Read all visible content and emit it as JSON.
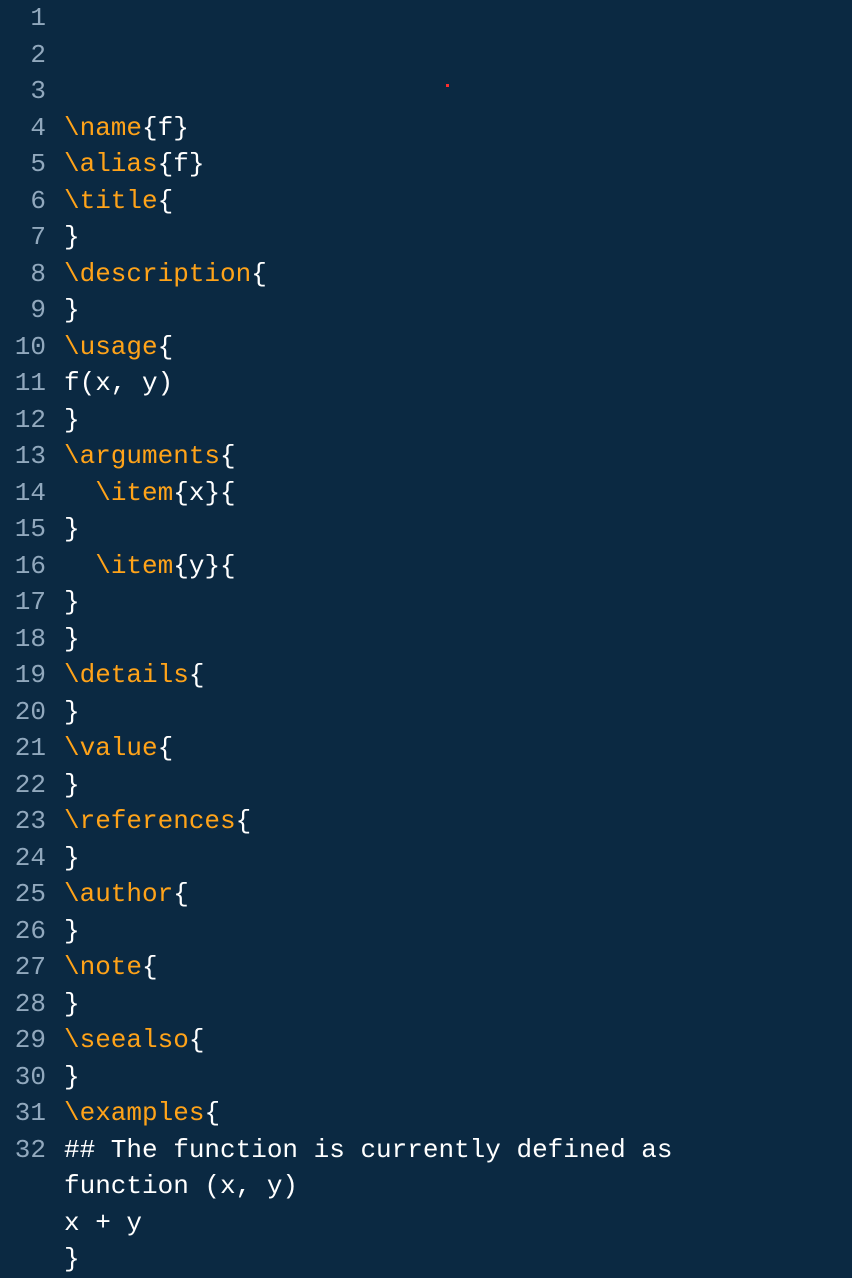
{
  "lines": [
    {
      "num": 1,
      "tokens": [
        {
          "t": "kw",
          "v": "\\name"
        },
        {
          "t": "brace",
          "v": "{"
        },
        {
          "t": "arg",
          "v": "f"
        },
        {
          "t": "brace",
          "v": "}"
        }
      ]
    },
    {
      "num": 2,
      "tokens": [
        {
          "t": "kw",
          "v": "\\alias"
        },
        {
          "t": "brace",
          "v": "{"
        },
        {
          "t": "arg",
          "v": "f"
        },
        {
          "t": "brace",
          "v": "}"
        }
      ]
    },
    {
      "num": 3,
      "tokens": [
        {
          "t": "kw",
          "v": "\\title"
        },
        {
          "t": "brace",
          "v": "{"
        }
      ]
    },
    {
      "num": 4,
      "tokens": [
        {
          "t": "brace",
          "v": "}"
        }
      ]
    },
    {
      "num": 5,
      "tokens": [
        {
          "t": "kw",
          "v": "\\description"
        },
        {
          "t": "brace",
          "v": "{"
        }
      ]
    },
    {
      "num": 6,
      "tokens": [
        {
          "t": "brace",
          "v": "}"
        }
      ]
    },
    {
      "num": 7,
      "tokens": [
        {
          "t": "kw",
          "v": "\\usage"
        },
        {
          "t": "brace",
          "v": "{"
        }
      ]
    },
    {
      "num": 8,
      "tokens": [
        {
          "t": "txt",
          "v": "f(x, y)"
        }
      ]
    },
    {
      "num": 9,
      "tokens": [
        {
          "t": "brace",
          "v": "}"
        }
      ]
    },
    {
      "num": 10,
      "tokens": [
        {
          "t": "kw",
          "v": "\\arguments"
        },
        {
          "t": "brace",
          "v": "{"
        }
      ]
    },
    {
      "num": 11,
      "tokens": [
        {
          "t": "indent",
          "v": "  "
        },
        {
          "t": "kw",
          "v": "\\item"
        },
        {
          "t": "brace",
          "v": "{"
        },
        {
          "t": "arg",
          "v": "x"
        },
        {
          "t": "brace",
          "v": "}{"
        }
      ]
    },
    {
      "num": 12,
      "tokens": [
        {
          "t": "brace",
          "v": "}"
        }
      ]
    },
    {
      "num": 13,
      "tokens": [
        {
          "t": "indent",
          "v": "  "
        },
        {
          "t": "kw",
          "v": "\\item"
        },
        {
          "t": "brace",
          "v": "{"
        },
        {
          "t": "arg",
          "v": "y"
        },
        {
          "t": "brace",
          "v": "}{"
        }
      ]
    },
    {
      "num": 14,
      "tokens": [
        {
          "t": "brace",
          "v": "}"
        }
      ]
    },
    {
      "num": 15,
      "tokens": [
        {
          "t": "brace",
          "v": "}"
        }
      ]
    },
    {
      "num": 16,
      "tokens": [
        {
          "t": "kw",
          "v": "\\details"
        },
        {
          "t": "brace",
          "v": "{"
        }
      ]
    },
    {
      "num": 17,
      "tokens": [
        {
          "t": "brace",
          "v": "}"
        }
      ]
    },
    {
      "num": 18,
      "tokens": [
        {
          "t": "kw",
          "v": "\\value"
        },
        {
          "t": "brace",
          "v": "{"
        }
      ]
    },
    {
      "num": 19,
      "tokens": [
        {
          "t": "brace",
          "v": "}"
        }
      ]
    },
    {
      "num": 20,
      "tokens": [
        {
          "t": "kw",
          "v": "\\references"
        },
        {
          "t": "brace",
          "v": "{"
        }
      ]
    },
    {
      "num": 21,
      "tokens": [
        {
          "t": "brace",
          "v": "}"
        }
      ]
    },
    {
      "num": 22,
      "tokens": [
        {
          "t": "kw",
          "v": "\\author"
        },
        {
          "t": "brace",
          "v": "{"
        }
      ]
    },
    {
      "num": 23,
      "tokens": [
        {
          "t": "brace",
          "v": "}"
        }
      ]
    },
    {
      "num": 24,
      "tokens": [
        {
          "t": "kw",
          "v": "\\note"
        },
        {
          "t": "brace",
          "v": "{"
        }
      ]
    },
    {
      "num": 25,
      "tokens": [
        {
          "t": "brace",
          "v": "}"
        }
      ]
    },
    {
      "num": 26,
      "tokens": [
        {
          "t": "kw",
          "v": "\\seealso"
        },
        {
          "t": "brace",
          "v": "{"
        }
      ]
    },
    {
      "num": 27,
      "tokens": [
        {
          "t": "brace",
          "v": "}"
        }
      ]
    },
    {
      "num": 28,
      "tokens": [
        {
          "t": "kw",
          "v": "\\examples"
        },
        {
          "t": "brace",
          "v": "{"
        }
      ]
    },
    {
      "num": 29,
      "tokens": [
        {
          "t": "txt",
          "v": "## The function is currently defined as"
        }
      ]
    },
    {
      "num": 30,
      "tokens": [
        {
          "t": "txt",
          "v": "function (x, y)"
        }
      ]
    },
    {
      "num": 31,
      "tokens": [
        {
          "t": "txt",
          "v": "x + y"
        }
      ]
    },
    {
      "num": 32,
      "tokens": [
        {
          "t": "brace",
          "v": "}"
        }
      ]
    }
  ]
}
